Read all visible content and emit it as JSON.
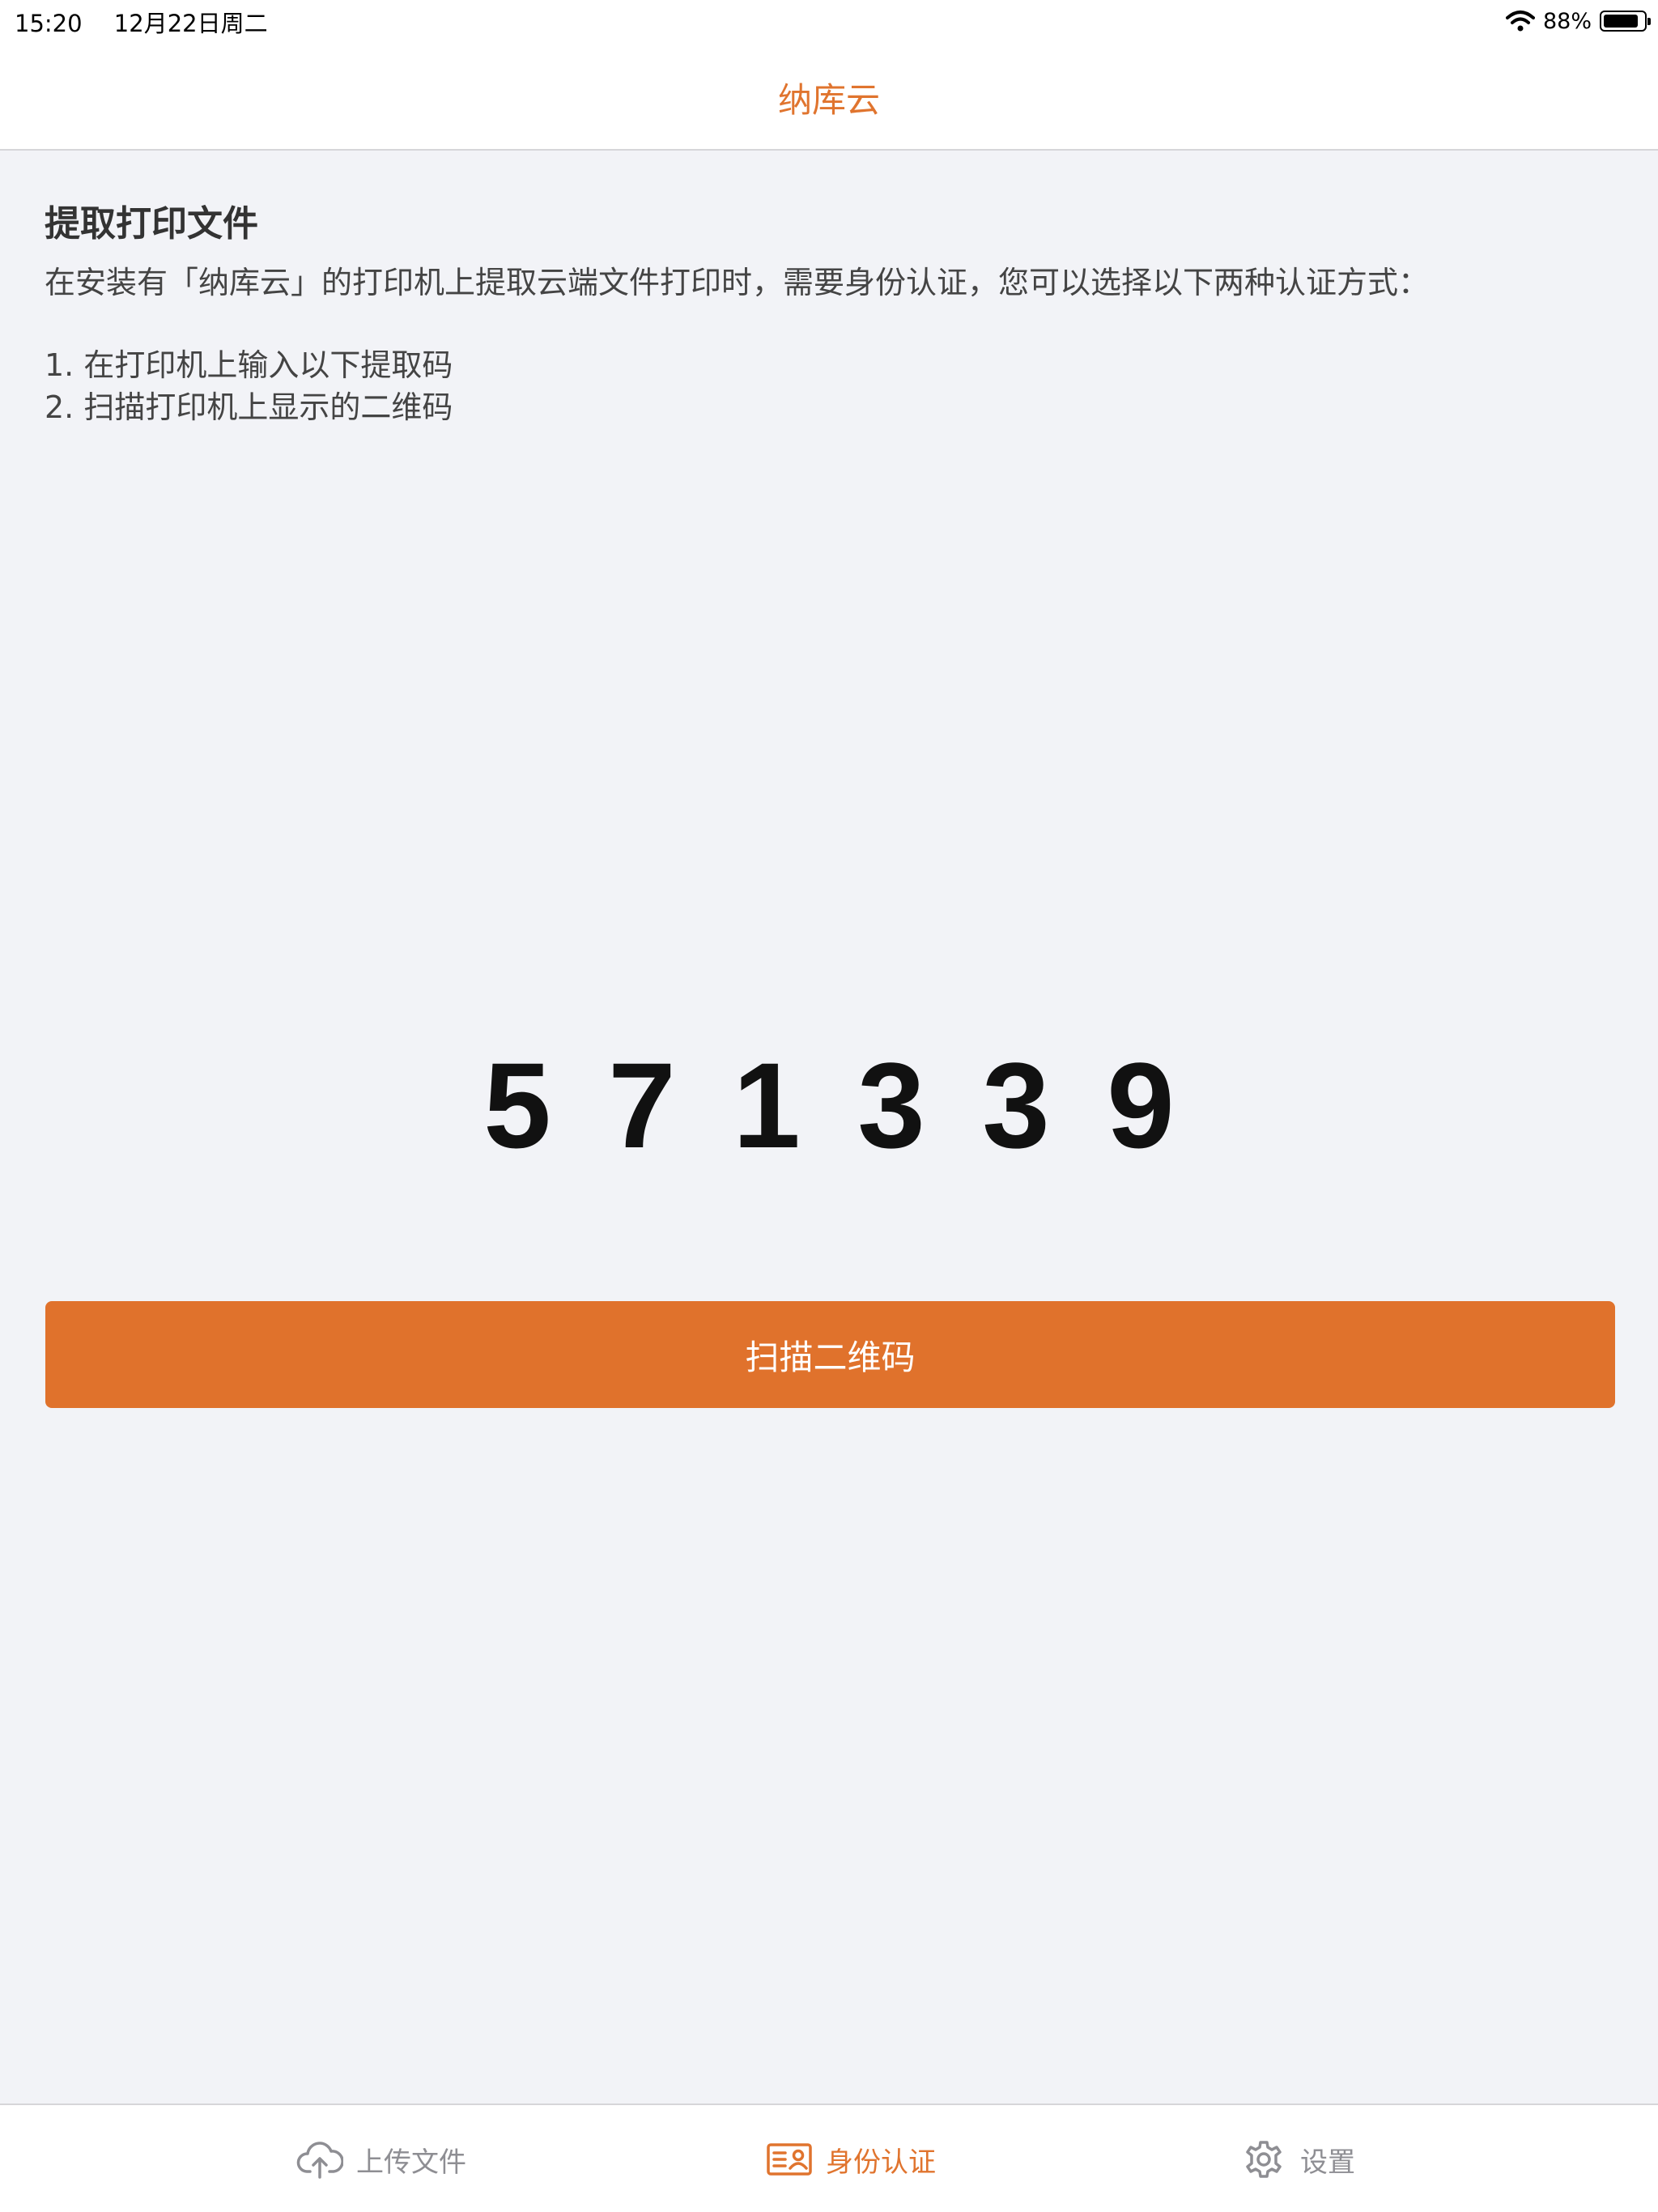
{
  "status_bar": {
    "time": "15:20",
    "date": "12月22日周二",
    "battery_percent": "88%",
    "battery_level": 0.88
  },
  "nav": {
    "title": "纳库云"
  },
  "content": {
    "title": "提取打印文件",
    "description": "在安装有「纳库云」的打印机上提取云端文件打印时，需要身份认证，您可以选择以下两种认证方式：",
    "methods": [
      "1. 在打印机上输入以下提取码",
      "2. 扫描打印机上显示的二维码"
    ],
    "code_digits": [
      "5",
      "7",
      "1",
      "3",
      "3",
      "9"
    ],
    "scan_button_label": "扫描二维码"
  },
  "tab_bar": {
    "tabs": [
      {
        "label": "上传文件",
        "icon": "cloud-upload-icon",
        "active": false
      },
      {
        "label": "身份认证",
        "icon": "id-card-icon",
        "active": true
      },
      {
        "label": "设置",
        "icon": "gear-icon",
        "active": false
      }
    ]
  },
  "colors": {
    "accent": "#e0742e",
    "background": "#f2f3f7",
    "tab_inactive": "#8e8e93"
  }
}
